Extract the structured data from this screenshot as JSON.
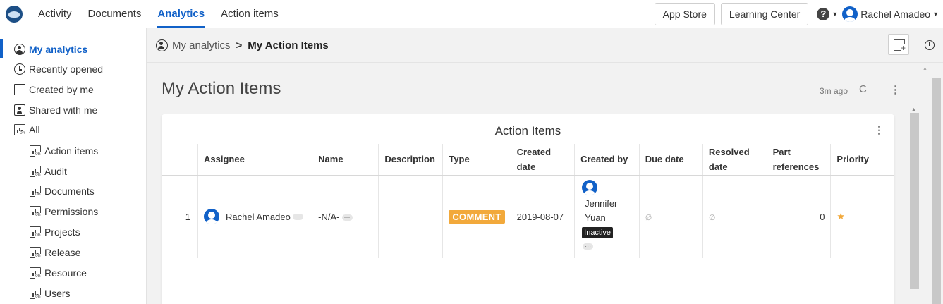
{
  "topnav": {
    "tabs": [
      "Activity",
      "Documents",
      "Analytics",
      "Action items"
    ],
    "active_tab": "Analytics",
    "app_store": "App Store",
    "learning_center": "Learning Center",
    "user_name": "Rachel Amadeo",
    "help_icon": "question-circle-icon"
  },
  "sidebar": {
    "items": [
      {
        "label": "My analytics",
        "icon": "user-circle-icon"
      },
      {
        "label": "Recently opened",
        "icon": "clock-icon"
      },
      {
        "label": "Created by me",
        "icon": "file-icon"
      },
      {
        "label": "Shared with me",
        "icon": "shared-icon"
      },
      {
        "label": "All",
        "icon": "chart-icon"
      }
    ],
    "subitems": [
      "Action items",
      "Audit",
      "Documents",
      "Permissions",
      "Projects",
      "Release",
      "Resource",
      "Users"
    ]
  },
  "breadcrumb": {
    "root": "My analytics",
    "separator": ">",
    "current": "My Action Items"
  },
  "page": {
    "title": "My Action Items",
    "refreshed": "3m ago",
    "refresh_icon": "C",
    "more_icon": "⋮"
  },
  "card": {
    "title": "Action Items",
    "more_icon": "⋮",
    "columns": [
      "Assignee",
      "Name",
      "Description",
      "Type",
      "Created date",
      "Created by",
      "Due date",
      "Resolved date",
      "Part references",
      "Priority"
    ],
    "rows": [
      {
        "index": "1",
        "assignee": "Rachel Amadeo",
        "name": "-N/A-",
        "description": "",
        "type": "COMMENT",
        "created_date": "2019-08-07",
        "created_by": "Jennifer Yuan",
        "created_by_status": "Inactive",
        "due_date": "∅",
        "resolved_date": "∅",
        "part_references": "0",
        "priority": "★"
      }
    ],
    "dots": "···"
  },
  "colors": {
    "accent": "#1161c8",
    "comment_badge": "#f2a93b",
    "background": "#f2f2f2"
  }
}
